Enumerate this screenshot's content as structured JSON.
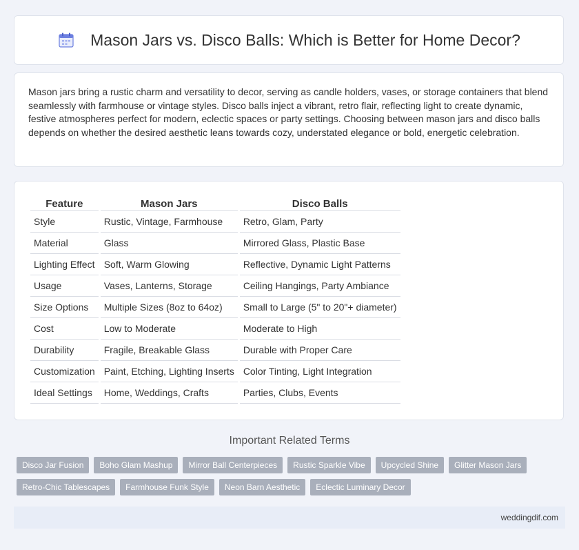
{
  "header": {
    "title": "Mason Jars vs. Disco Balls: Which is Better for Home Decor?",
    "icon": "calendar-icon"
  },
  "intro": {
    "text": "Mason jars bring a rustic charm and versatility to decor, serving as candle holders, vases, or storage containers that blend seamlessly with farmhouse or vintage styles. Disco balls inject a vibrant, retro flair, reflecting light to create dynamic, festive atmospheres perfect for modern, eclectic spaces or party settings. Choosing between mason jars and disco balls depends on whether the desired aesthetic leans towards cozy, understated elegance or bold, energetic celebration."
  },
  "table": {
    "headers": [
      "Feature",
      "Mason Jars",
      "Disco Balls"
    ],
    "rows": [
      [
        "Style",
        "Rustic, Vintage, Farmhouse",
        "Retro, Glam, Party"
      ],
      [
        "Material",
        "Glass",
        "Mirrored Glass, Plastic Base"
      ],
      [
        "Lighting Effect",
        "Soft, Warm Glowing",
        "Reflective, Dynamic Light Patterns"
      ],
      [
        "Usage",
        "Vases, Lanterns, Storage",
        "Ceiling Hangings, Party Ambiance"
      ],
      [
        "Size Options",
        "Multiple Sizes (8oz to 64oz)",
        "Small to Large (5\" to 20\"+ diameter)"
      ],
      [
        "Cost",
        "Low to Moderate",
        "Moderate to High"
      ],
      [
        "Durability",
        "Fragile, Breakable Glass",
        "Durable with Proper Care"
      ],
      [
        "Customization",
        "Paint, Etching, Lighting Inserts",
        "Color Tinting, Light Integration"
      ],
      [
        "Ideal Settings",
        "Home, Weddings, Crafts",
        "Parties, Clubs, Events"
      ]
    ]
  },
  "related": {
    "title": "Important Related Terms",
    "tags": [
      "Disco Jar Fusion",
      "Boho Glam Mashup",
      "Mirror Ball Centerpieces",
      "Rustic Sparkle Vibe",
      "Upcycled Shine",
      "Glitter Mason Jars",
      "Retro-Chic Tablescapes",
      "Farmhouse Funk Style",
      "Neon Barn Aesthetic",
      "Eclectic Luminary Decor"
    ]
  },
  "footer": {
    "site": "weddingdif.com"
  }
}
